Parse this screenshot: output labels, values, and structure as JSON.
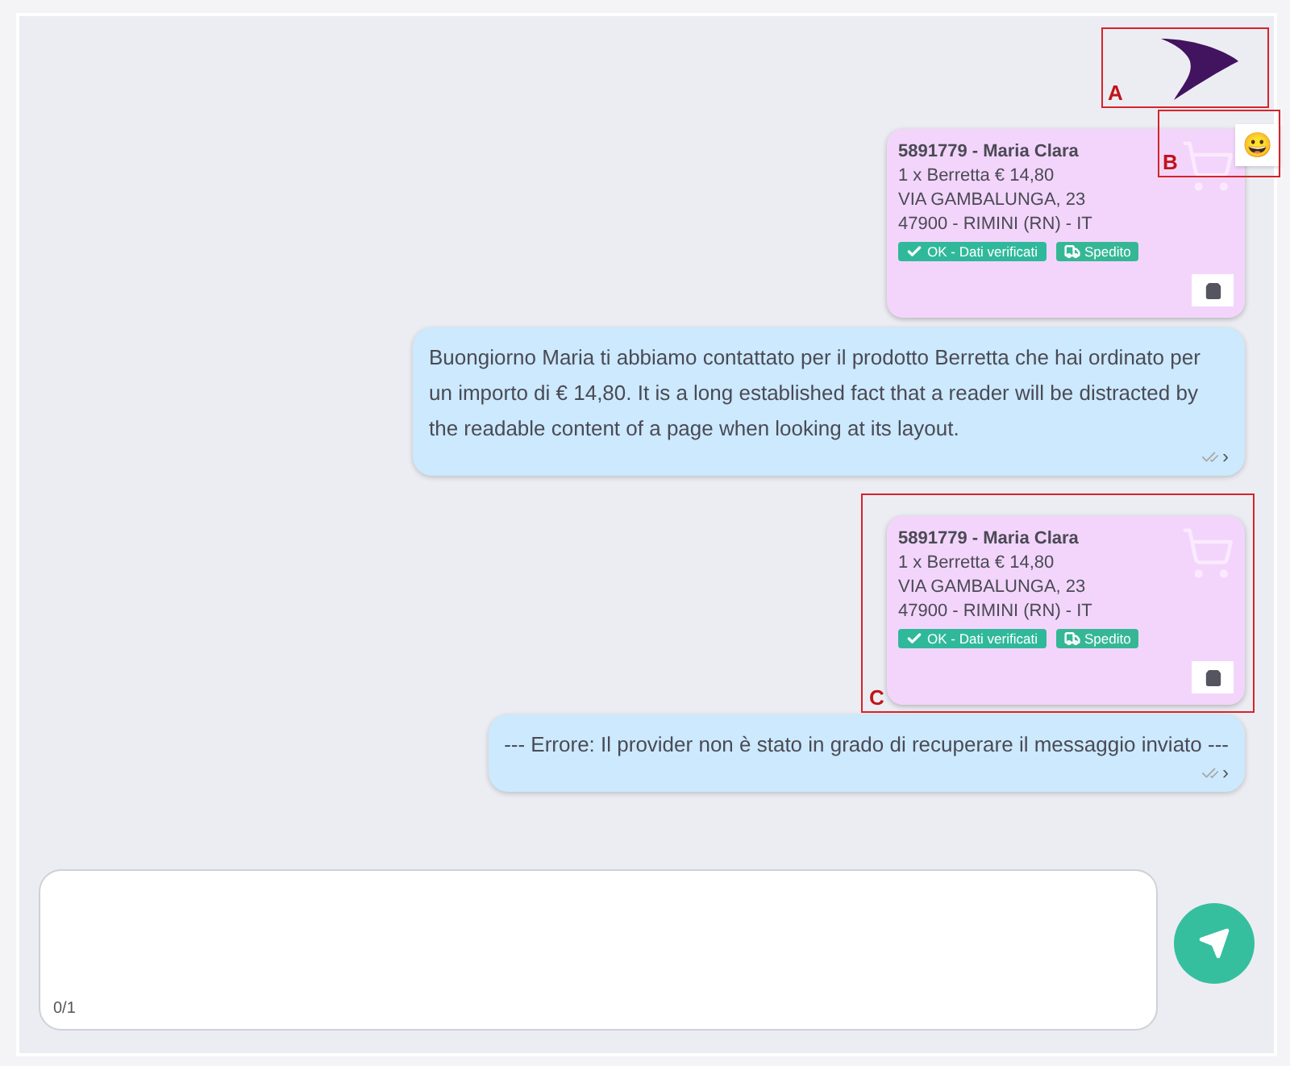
{
  "messages": [
    {
      "kind": "order",
      "title": "5891779 - Maria Clara",
      "lines": [
        "1 x Berretta € 14,80",
        "VIA GAMBALUNGA, 23",
        "47900 - RIMINI (RN) - IT"
      ],
      "badges": [
        {
          "kind": "verified",
          "label": "OK - Dati verificati"
        },
        {
          "kind": "shipped",
          "label": "Spedito"
        }
      ],
      "reaction": "😀"
    },
    {
      "kind": "text",
      "text": "Buongiorno Maria ti abbiamo contattato per il prodotto Berretta che hai ordinato per un importo di € 14,80. It is a long established fact that a reader will be distracted by the readable content of a page when looking at its layout.",
      "status": "›"
    },
    {
      "kind": "order",
      "title": "5891779 - Maria Clara",
      "lines": [
        "1 x Berretta € 14,80",
        "VIA GAMBALUNGA, 23",
        "47900 - RIMINI (RN) - IT"
      ],
      "badges": [
        {
          "kind": "verified",
          "label": "OK - Dati verificati"
        },
        {
          "kind": "shipped",
          "label": "Spedito"
        }
      ]
    },
    {
      "kind": "text",
      "text": "--- Errore: Il provider non è stato in grado di recuperare il messaggio inviato ---",
      "status": "›"
    }
  ],
  "annotations": [
    {
      "label": "A"
    },
    {
      "label": "B"
    },
    {
      "label": "C"
    }
  ],
  "composer": {
    "counter": "0/1"
  }
}
